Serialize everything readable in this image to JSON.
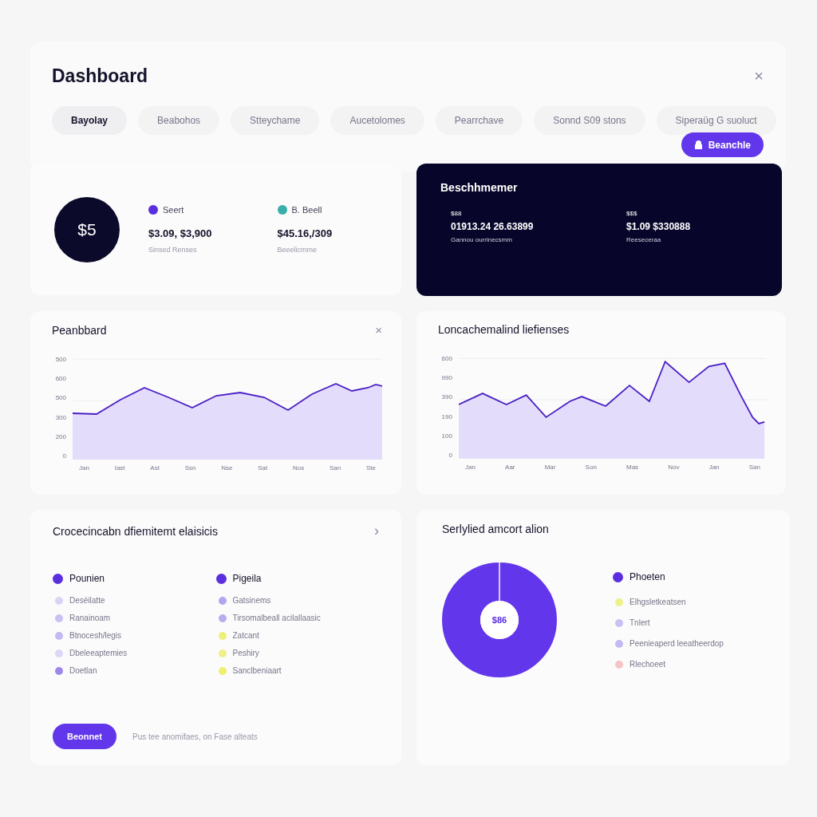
{
  "header": {
    "title": "Dashboard",
    "close": "×"
  },
  "tabs": [
    {
      "label": "Bayolay",
      "selected": true
    },
    {
      "label": "Beabohos",
      "selected": false
    },
    {
      "label": "Stteychame",
      "selected": false
    },
    {
      "label": "Aucetolomes",
      "selected": false
    },
    {
      "label": "Pearrchave",
      "selected": false
    },
    {
      "label": "Sonnd S09 stons",
      "selected": false
    },
    {
      "label": "Siperaüg G suoluct",
      "selected": false
    }
  ],
  "action_button": {
    "label": "Beanchle"
  },
  "summary": {
    "badge": "$5",
    "stats": [
      {
        "label": "Seert",
        "value": "$3.09, $3,900",
        "caption": "Sinsed Renses",
        "color": "#5b2ee0"
      },
      {
        "label": "B. Beell",
        "value": "$45.16,/309",
        "caption": "Beeelicmme",
        "color": "#3aaea8"
      }
    ]
  },
  "highlight": {
    "title": "Beschhmemer",
    "stats": [
      {
        "label": "$88",
        "value": "01913.24 26.63899",
        "caption": "Gannou ourrinecsmm"
      },
      {
        "label": "$$$",
        "value": "$1.09 $330888",
        "caption": "Reeseceraa"
      }
    ]
  },
  "charts": [
    {
      "title": "Peanbbard",
      "close": "×",
      "y_labels": [
        "500",
        "600",
        "500",
        "300",
        "200",
        "0"
      ],
      "x_labels": [
        "Jan",
        "Iast",
        "Ast",
        "Ssn",
        "Nse",
        "Sat",
        "Nos",
        "San",
        "Ste"
      ]
    },
    {
      "title": "Loncachemalind liefienses",
      "y_labels": [
        "600",
        "990",
        "390",
        "190",
        "100",
        "0"
      ],
      "x_labels": [
        "Jan",
        "Aar",
        "Mar",
        "Son",
        "Mas",
        "Nov",
        "Jan",
        "San"
      ]
    }
  ],
  "legend_card": {
    "title": "Crocecincabn dfiemitemt elaisicis",
    "chevron": "›",
    "columns": [
      [
        {
          "kind": "heading",
          "label": "Pounien",
          "color": "#5b2ee0"
        },
        {
          "kind": "item",
          "label": "Deséilatte",
          "color": "#d9d4f5"
        },
        {
          "kind": "item",
          "label": "Ranainoam",
          "color": "#c9c0f3"
        },
        {
          "kind": "item",
          "label": "Btnocesh/legis",
          "color": "#c4b9f2"
        },
        {
          "kind": "item",
          "label": "Dbeleeaptemies",
          "color": "#dcd7f6"
        },
        {
          "kind": "item",
          "label": "Doetlan",
          "color": "#9d88ea"
        }
      ],
      [
        {
          "kind": "heading",
          "label": "Pigeila",
          "color": "#5b2ee0"
        },
        {
          "kind": "item",
          "label": "Gatsinems",
          "color": "#b3a6ef"
        },
        {
          "kind": "item",
          "label": "Tirsomalbeall acilallaasic",
          "color": "#b9adf0"
        },
        {
          "kind": "item",
          "label": "Zatcant",
          "color": "#eef07a"
        },
        {
          "kind": "item",
          "label": "Peshiry",
          "color": "#eef08a"
        },
        {
          "kind": "item",
          "label": "Sanclbeniaart",
          "color": "#eef070"
        }
      ]
    ],
    "button": "Beonnet",
    "note": "Pus tee anomifaes, on Fase alteats"
  },
  "allocation": {
    "title": "Serlylied amcort alion",
    "center": "$86",
    "legend": [
      {
        "kind": "heading",
        "label": "Phoeten",
        "color": "#5b2ee0"
      },
      {
        "kind": "item",
        "label": "Elhgsletkeatsen",
        "color": "#eef08a"
      },
      {
        "kind": "item",
        "label": "Tnlert",
        "color": "#c9c0f3"
      },
      {
        "kind": "item",
        "label": "Peenieaperd leeatheerdop",
        "color": "#c4b9f2"
      },
      {
        "kind": "item",
        "label": "Rlechoeet",
        "color": "#f5c4c4"
      }
    ]
  }
}
